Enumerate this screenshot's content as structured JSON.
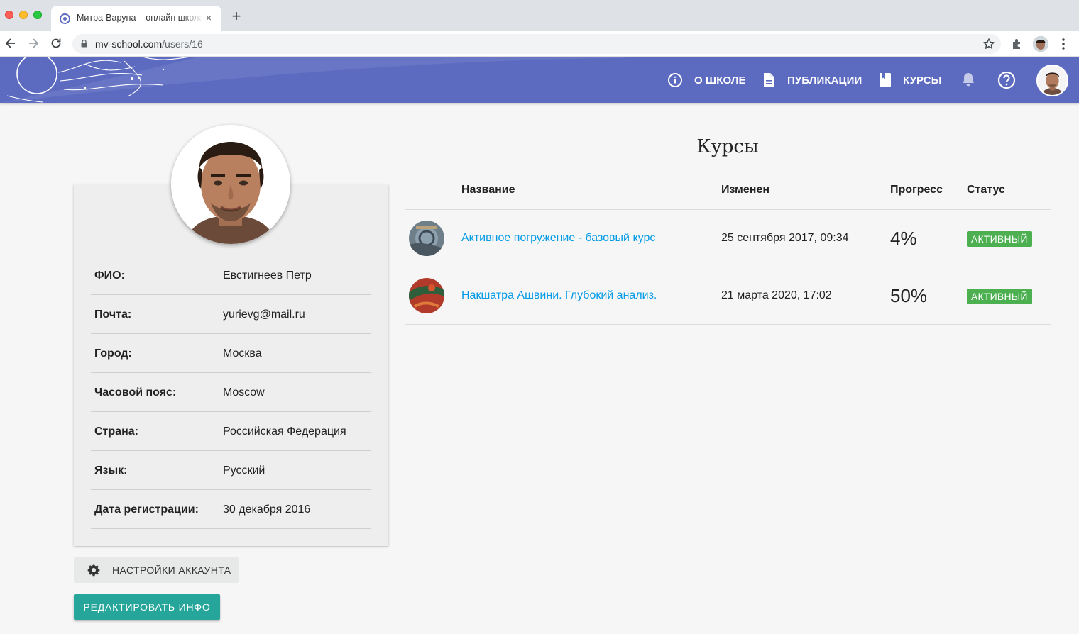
{
  "browser": {
    "tab_title": "Митра-Варуна – онлайн школа",
    "tab_close": "×",
    "new_tab": "+",
    "url_host": "mv-school.com",
    "url_path": "/users/16"
  },
  "header": {
    "nav": [
      {
        "label": "О ШКОЛЕ",
        "icon": "info-icon"
      },
      {
        "label": "ПУБЛИКАЦИИ",
        "icon": "document-icon"
      },
      {
        "label": "КУРСЫ",
        "icon": "book-icon"
      }
    ],
    "bell_icon": "bell-icon",
    "help_icon": "help-icon"
  },
  "profile": {
    "fields": [
      {
        "key": "ФИО:",
        "value": "Евстигнеев Петр"
      },
      {
        "key": "Почта:",
        "value": "yurievg@mail.ru"
      },
      {
        "key": "Город:",
        "value": "Москва"
      },
      {
        "key": "Часовой пояс:",
        "value": "Moscow"
      },
      {
        "key": "Страна:",
        "value": "Российская Федерация"
      },
      {
        "key": "Язык:",
        "value": "Русский"
      },
      {
        "key": "Дата регистрации:",
        "value": "30 декабря 2016"
      }
    ],
    "settings_button": "НАСТРОЙКИ АККАУНТА",
    "edit_button": "РЕДАКТИРОВАТЬ ИНФО"
  },
  "courses": {
    "title": "Курсы",
    "headers": {
      "name": "Название",
      "changed": "Изменен",
      "progress": "Прогресс",
      "status": "Статус"
    },
    "rows": [
      {
        "name": "Активное погружение - базовый курс",
        "changed": "25 сентября 2017, 09:34",
        "progress": "4%",
        "status": "АКТИВНЫЙ"
      },
      {
        "name": "Накшатра Ашвини. Глубокий анализ.",
        "changed": "21 марта 2020, 17:02",
        "progress": "50%",
        "status": "АКТИВНЫЙ"
      }
    ]
  },
  "colors": {
    "header": "#5c6bc0",
    "accent_teal": "#26a69a",
    "link": "#039be5",
    "badge_green": "#4caf50"
  }
}
